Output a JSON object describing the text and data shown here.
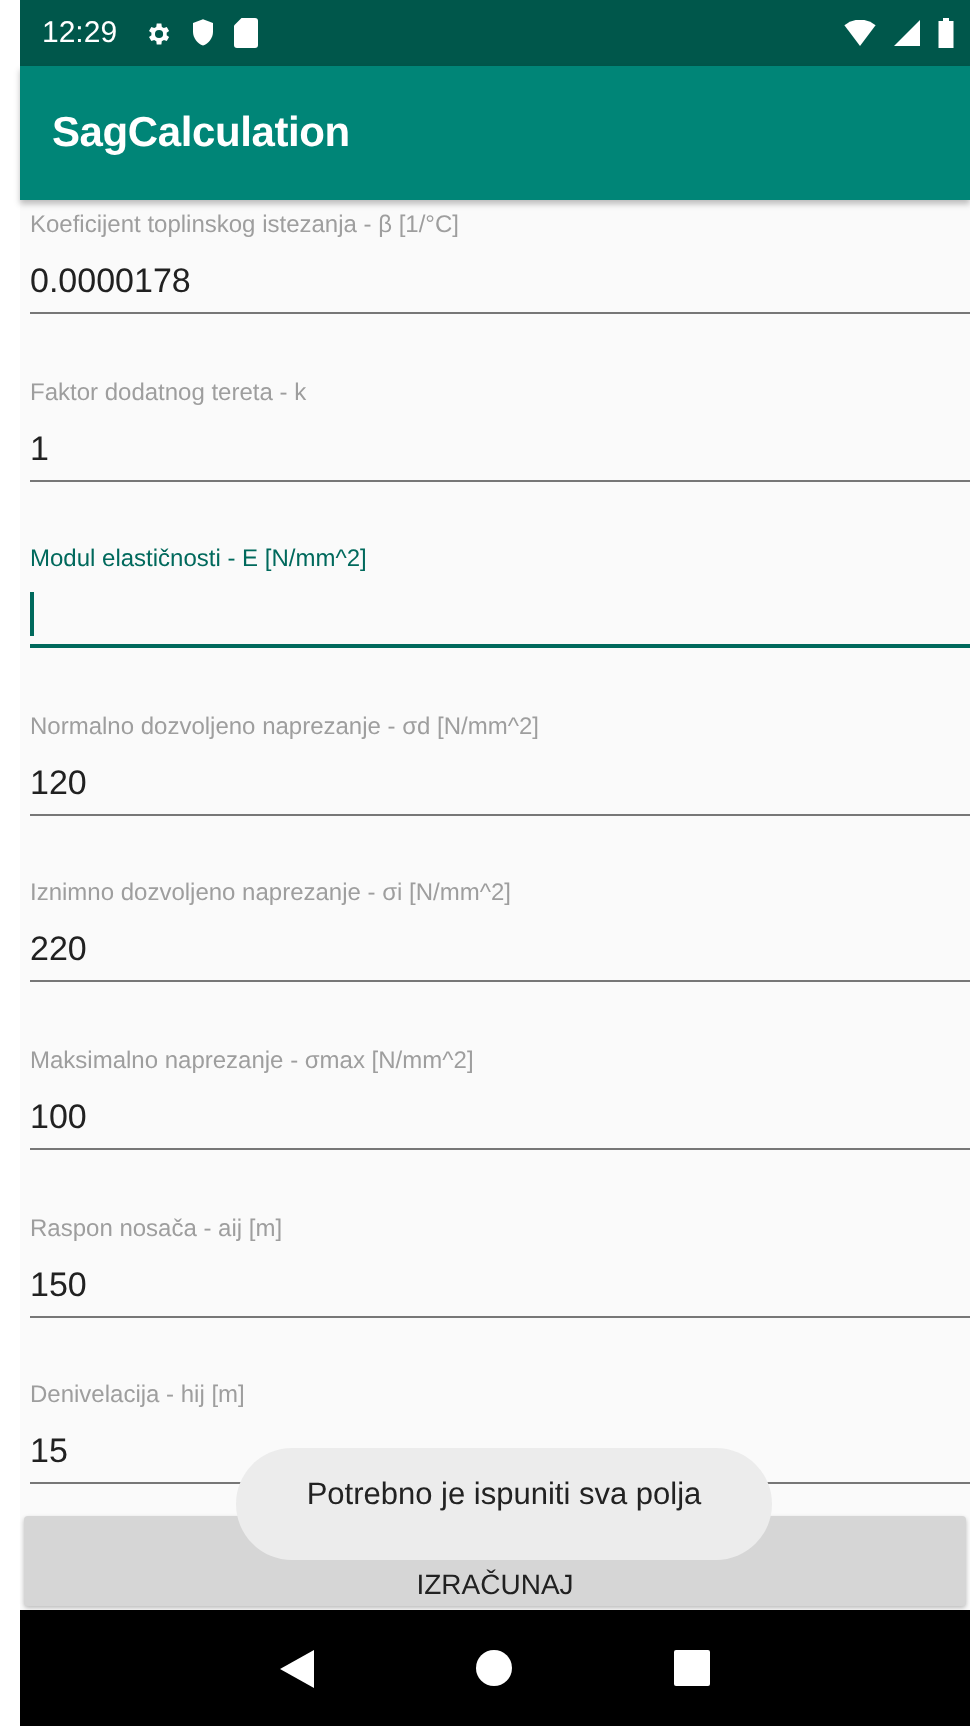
{
  "status_bar": {
    "time": "12:29"
  },
  "app_bar": {
    "title": "SagCalculation"
  },
  "fields": [
    {
      "label": "Koeficijent toplinskog istezanja - β [1/°C]",
      "value": "0.0000178",
      "focused": false
    },
    {
      "label": "Faktor dodatnog tereta - k",
      "value": "1",
      "focused": false
    },
    {
      "label": "Modul elastičnosti - E [N/mm^2]",
      "focused": true
    },
    {
      "label": "Normalno dozvoljeno naprezanje - σd [N/mm^2]",
      "value": "120",
      "focused": false
    },
    {
      "label": "Iznimno dozvoljeno naprezanje - σi [N/mm^2]",
      "value": "220",
      "focused": false
    },
    {
      "label": "Maksimalno naprezanje - σmax [N/mm^2]",
      "value": "100",
      "focused": false
    },
    {
      "label": "Raspon nosača - aij [m]",
      "value": "150",
      "focused": false
    },
    {
      "label": "Denivelacija - hij [m]",
      "value": "15",
      "focused": false
    }
  ],
  "button": {
    "label": "IZRAČUNAJ"
  },
  "toast": {
    "text": "Potrebno je ispuniti sva polja"
  }
}
